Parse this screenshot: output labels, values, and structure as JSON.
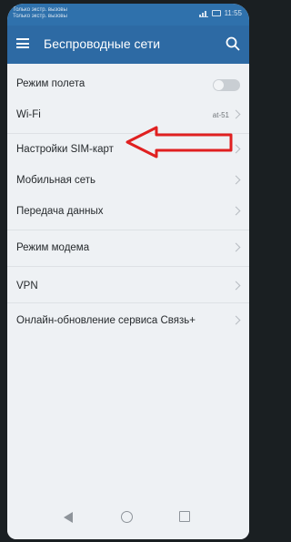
{
  "status_bar": {
    "left_text_line1": "Только экстр. вызовы",
    "left_text_line2": "Только экстр. вызовы",
    "time": "11:55"
  },
  "app_bar": {
    "title": "Беспроводные сети"
  },
  "settings": [
    {
      "label": "Режим полета",
      "control": "toggle",
      "toggle_on": false
    },
    {
      "label": "Wi-Fi",
      "value": "at-51"
    },
    {
      "label": "Настройки SIM-карт"
    },
    {
      "label": "Мобильная сеть"
    },
    {
      "label": "Передача данных"
    },
    {
      "label": "Режим модема"
    },
    {
      "label": "VPN"
    },
    {
      "label": "Онлайн-обновление сервиса Связь+"
    }
  ],
  "annotation": {
    "type": "red-arrow",
    "color": "#e02020",
    "points_to": "Настройки SIM-карт"
  },
  "colors": {
    "app_bar": "#2d6aa4",
    "background": "#eef1f4",
    "annotation": "#e02020"
  },
  "icons": [
    "menu-icon",
    "search-icon",
    "chevron-right-icon",
    "back-icon",
    "home-icon",
    "recent-apps-icon"
  ]
}
